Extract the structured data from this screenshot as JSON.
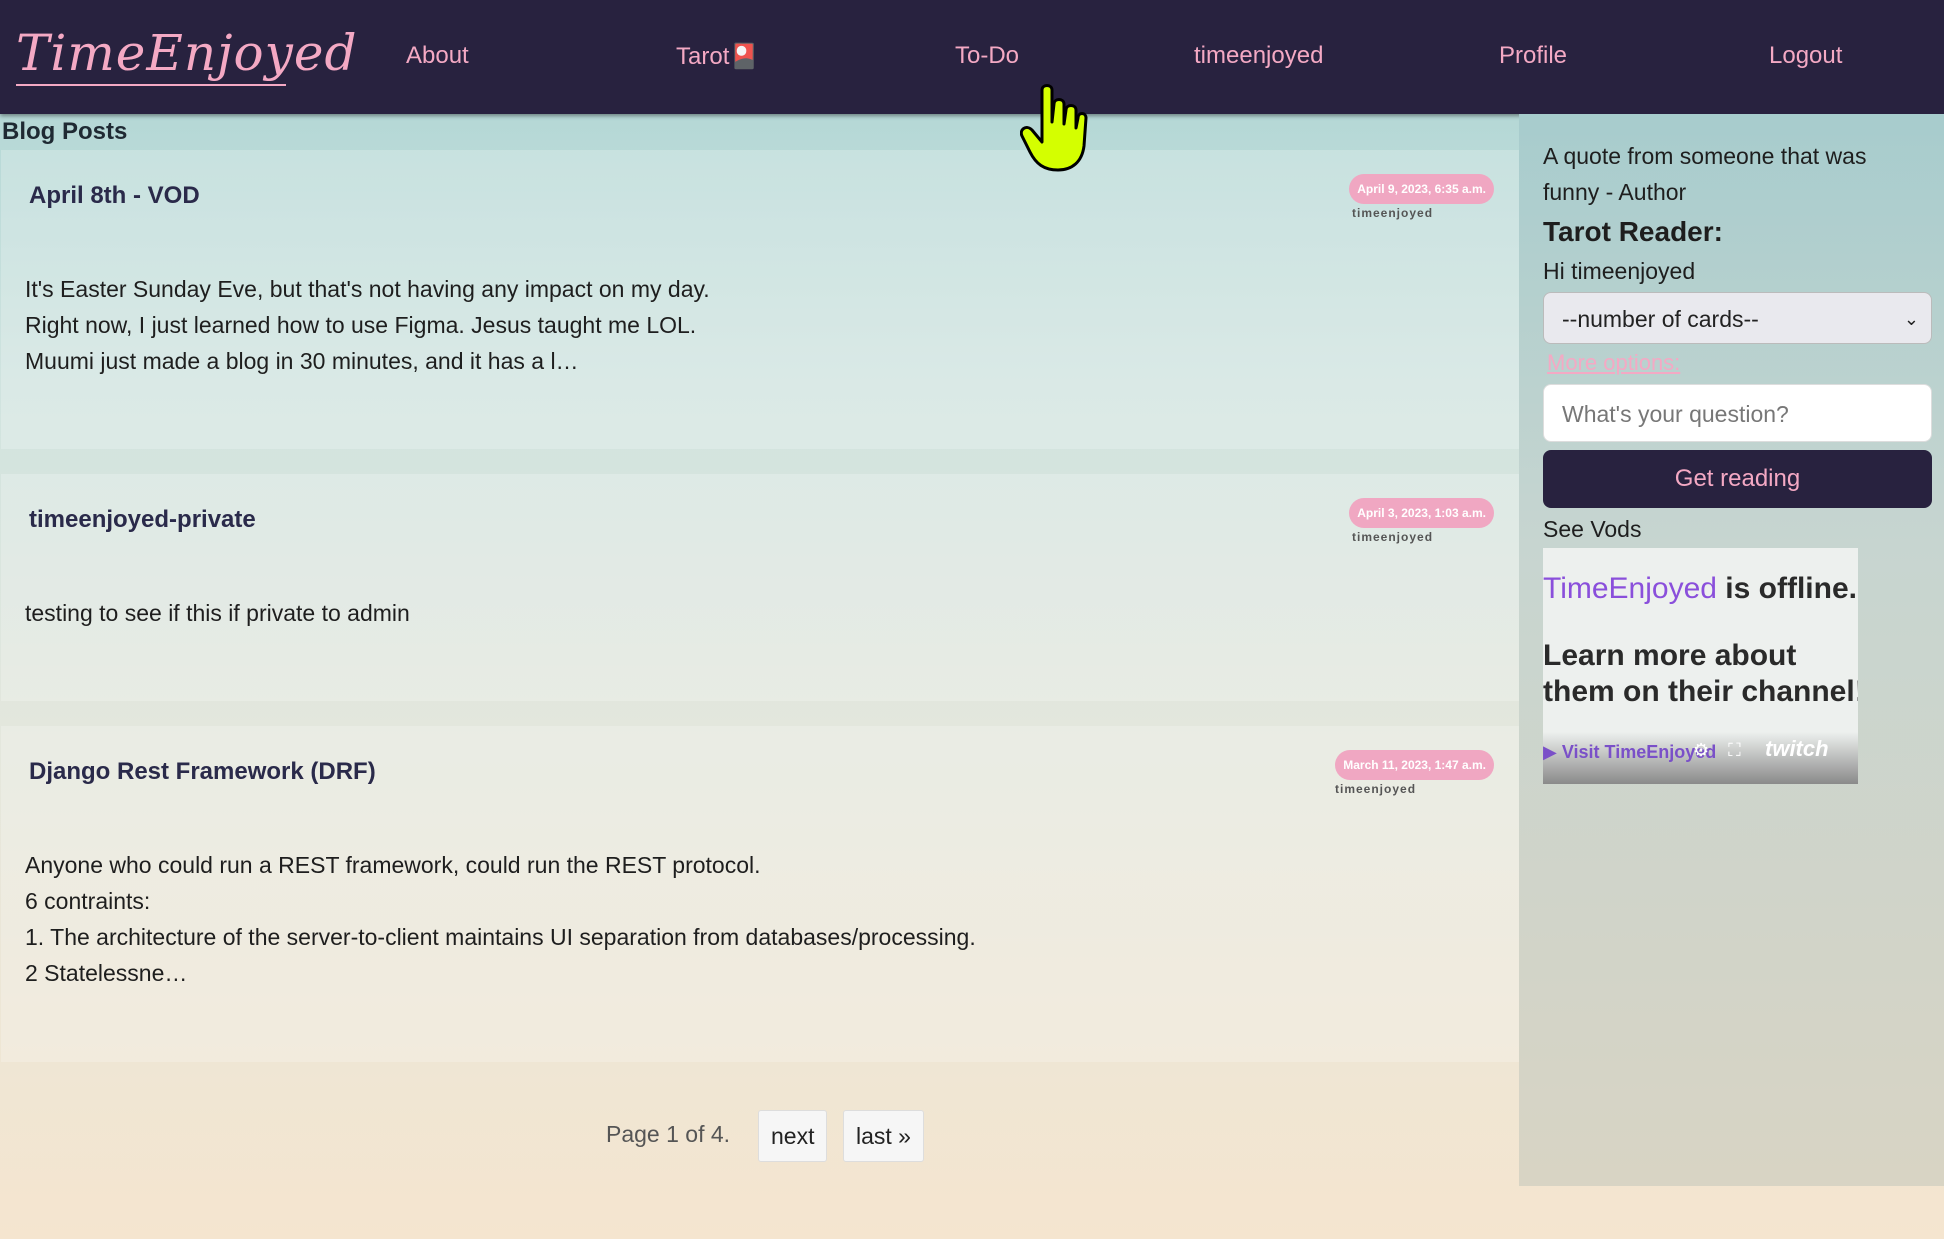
{
  "nav": {
    "logo": "TimeEnjoyed",
    "items": [
      "About",
      "Tarot🎴",
      "To-Do",
      "timeenjoyed",
      "Profile",
      "Logout"
    ]
  },
  "blog": {
    "heading": "Blog Posts",
    "posts": [
      {
        "title": "April 8th - VOD",
        "date": "April 9, 2023, 6:35 a.m.",
        "author": "timeenjoyed",
        "lines": [
          "It's Easter Sunday Eve, but that's not having any impact on my day.",
          "Right now, I just learned how to use Figma. Jesus taught me LOL.",
          "Muumi just made a blog in 30 minutes, and it has a l…"
        ]
      },
      {
        "title": "timeenjoyed-private",
        "date": "April 3, 2023, 1:03 a.m.",
        "author": "timeenjoyed",
        "lines": [
          "testing to see if this if private to admin"
        ]
      },
      {
        "title": "Django Rest Framework (DRF)",
        "date": "March 11, 2023, 1:47 a.m.",
        "author": "timeenjoyed",
        "lines": [
          "Anyone who could run a REST framework, could run the REST protocol.",
          "6 contraints:",
          "1. The architecture of the server-to-client maintains UI separation from databases/processing.",
          "2 Statelessne…"
        ]
      }
    ]
  },
  "pagination": {
    "status": "Page 1 of 4.",
    "next": "next",
    "last": "last »"
  },
  "sidebar": {
    "quote": "A quote from someone that was funny - Author",
    "tarot_title": "Tarot Reader:",
    "greeting": "Hi timeenjoyed",
    "select_value": "--number of cards--",
    "more_options": "More options:",
    "question_placeholder": "What's your question?",
    "get_reading": "Get reading",
    "see_vods": "See Vods"
  },
  "twitch": {
    "channel": "TimeEnjoyed",
    "offline_text": " is offline.",
    "learn_more": "Learn more about them on their channel!",
    "visit": "▶ Visit TimeEnjoyed",
    "brand": "twitch"
  },
  "colors": {
    "nav_bg": "#28223f",
    "accent_pink": "#f4a9c4",
    "twitch_purple": "#8a4fdb",
    "cursor_yellow": "#d4ff00"
  }
}
